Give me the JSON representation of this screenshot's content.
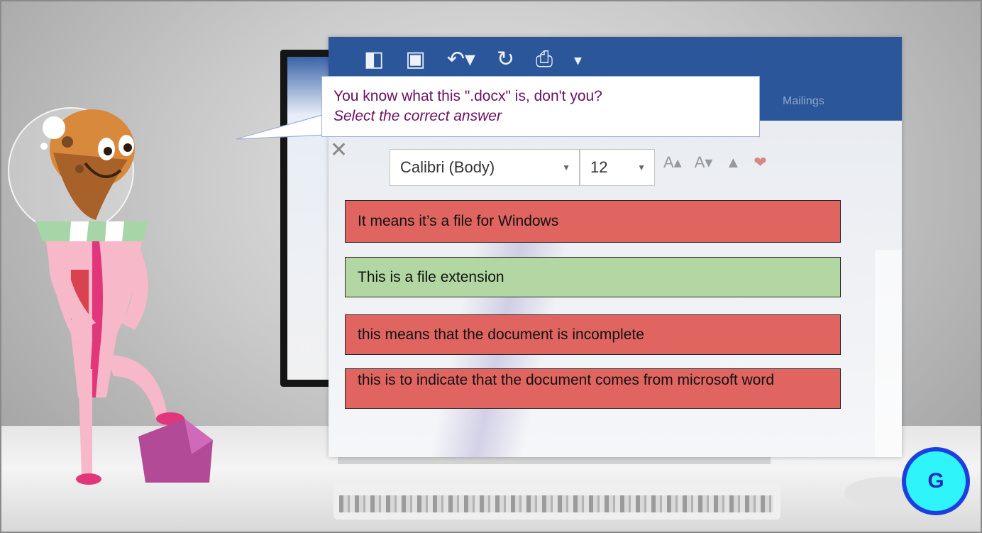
{
  "quiz": {
    "question": "You know what this \".docx\" is, don't you?",
    "hint": "Select the correct answer",
    "answers": [
      {
        "label": "It means it’s a file for Windows",
        "state": "wrong"
      },
      {
        "label": "This is a file extension",
        "state": "correct"
      },
      {
        "label": "this means that the document is incomplete",
        "state": "wrong"
      },
      {
        "label": "this is to indicate that the document comes from microsoft word",
        "state": "wrong"
      }
    ]
  },
  "background": {
    "font_name": "Calibri (Body)",
    "font_size": "12",
    "tab_text": "Mailings"
  },
  "controls": {
    "g_button_label": "G"
  },
  "colors": {
    "wrong": "#e06561",
    "correct": "#b3d7a3",
    "question_text": "#6b1060",
    "g_button_fill": "#2ff5fb",
    "g_button_ring": "#1e3fe0"
  },
  "icons": [
    "layout-icon",
    "save-icon",
    "undo-icon",
    "redo-icon",
    "print-icon",
    "customize-icon",
    "cut-icon",
    "grow-font-icon",
    "shrink-font-icon",
    "font-color-icon",
    "highlight-icon"
  ]
}
